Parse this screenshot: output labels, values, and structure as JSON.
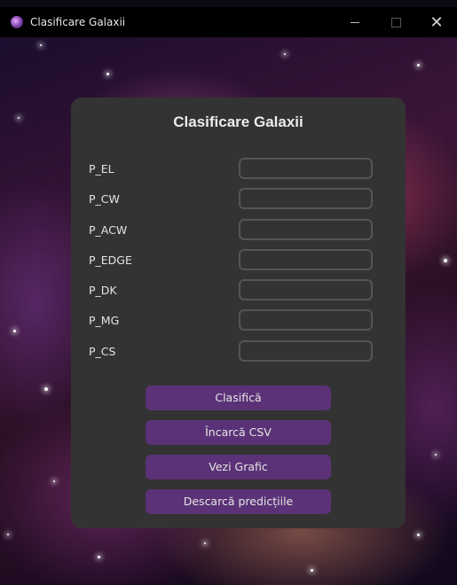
{
  "window": {
    "title": "Clasificare Galaxii",
    "controls": {
      "minimize": "—",
      "close": "✕"
    }
  },
  "form": {
    "title": "Clasificare Galaxii",
    "fields": [
      {
        "label": "P_EL",
        "value": ""
      },
      {
        "label": "P_CW",
        "value": ""
      },
      {
        "label": "P_ACW",
        "value": ""
      },
      {
        "label": "P_EDGE",
        "value": ""
      },
      {
        "label": "P_DK",
        "value": ""
      },
      {
        "label": "P_MG",
        "value": ""
      },
      {
        "label": "P_CS",
        "value": ""
      }
    ],
    "buttons": {
      "classify": "Clasifică",
      "load_csv": "Încarcă CSV",
      "view_chart": "Vezi Grafic",
      "download_predictions": "Descarcă predicțiile"
    }
  },
  "colors": {
    "panel_bg": "#333333",
    "button_bg": "#5b3277",
    "input_border": "#555555",
    "text": "#e3e3e3"
  }
}
